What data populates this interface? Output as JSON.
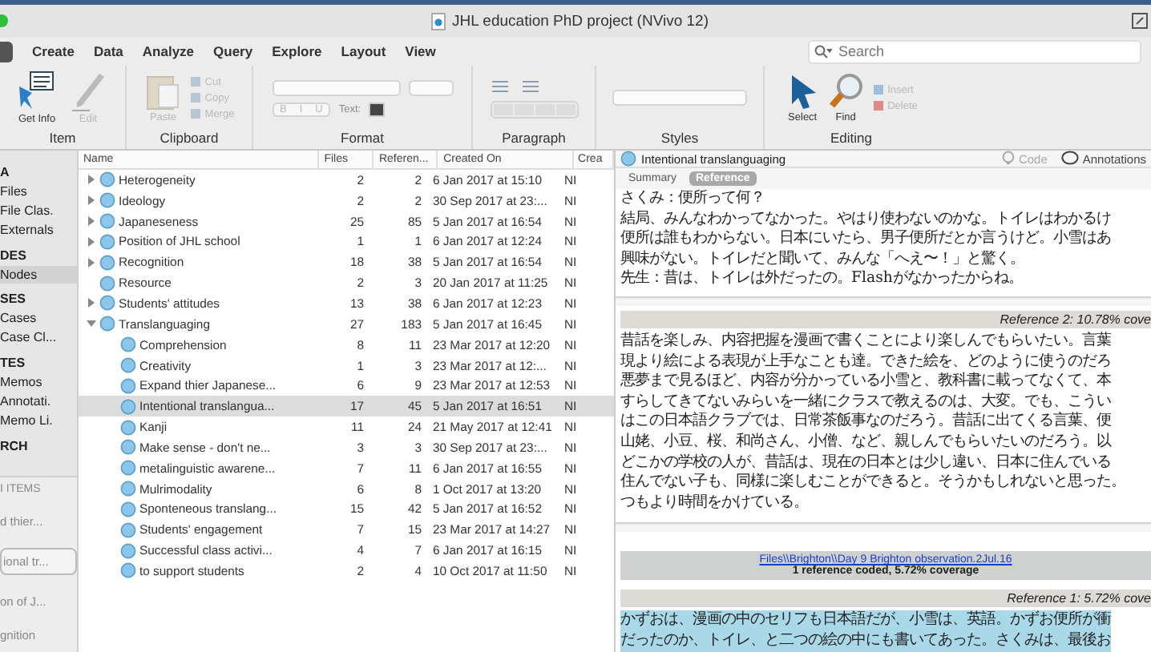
{
  "window": {
    "title": "JHL education PhD project (NVivo 12)"
  },
  "menu_tabs": [
    {
      "label": "Create"
    },
    {
      "label": "Data"
    },
    {
      "label": "Analyze"
    },
    {
      "label": "Query"
    },
    {
      "label": "Explore"
    },
    {
      "label": "Layout"
    },
    {
      "label": "View"
    }
  ],
  "search": {
    "placeholder": "Search"
  },
  "ribbon": [
    {
      "title": "Item",
      "kind": "item",
      "buttons": [
        {
          "label": "Get Info",
          "disabled": false
        },
        {
          "label": "Edit",
          "disabled": true
        }
      ]
    },
    {
      "title": "Clipboard",
      "kind": "clipboard",
      "buttons": [
        {
          "label": "Paste",
          "disabled": true
        },
        {
          "label": "Cut",
          "disabled": true
        },
        {
          "label": "Copy",
          "disabled": true
        },
        {
          "label": "Merge",
          "disabled": true
        }
      ]
    },
    {
      "title": "Format",
      "kind": "format",
      "buttons": [
        {
          "label": "B",
          "disabled": true
        },
        {
          "label": "I",
          "disabled": true
        },
        {
          "label": "U",
          "disabled": true
        },
        {
          "label": "Text:",
          "disabled": true
        }
      ]
    },
    {
      "title": "Paragraph",
      "kind": "paragraph"
    },
    {
      "title": "Styles",
      "kind": "styles"
    },
    {
      "title": "Editing",
      "kind": "editing",
      "buttons": [
        {
          "label": "Select",
          "disabled": false
        },
        {
          "label": "Find",
          "disabled": false
        },
        {
          "label": "Insert",
          "disabled": true
        },
        {
          "label": "Delete",
          "disabled": true
        }
      ]
    }
  ],
  "sidebar": {
    "items": [
      {
        "label": "A",
        "kind": "header",
        "selected": false
      },
      {
        "label": "Files",
        "kind": "item",
        "selected": false
      },
      {
        "label": "File Clas.",
        "kind": "item",
        "selected": false
      },
      {
        "label": "Externals",
        "kind": "item",
        "selected": false
      },
      {
        "label": "DES",
        "kind": "header",
        "selected": false
      },
      {
        "label": "Nodes",
        "kind": "item",
        "selected": true
      },
      {
        "label": "SES",
        "kind": "header",
        "selected": false
      },
      {
        "label": "Cases",
        "kind": "item",
        "selected": false
      },
      {
        "label": "Case Cl...",
        "kind": "item",
        "selected": false
      },
      {
        "label": "TES",
        "kind": "header",
        "selected": false
      },
      {
        "label": "Memos",
        "kind": "item",
        "selected": false
      },
      {
        "label": "Annotati.",
        "kind": "item",
        "selected": false
      },
      {
        "label": "Memo Li.",
        "kind": "item",
        "selected": false
      },
      {
        "label": "RCH",
        "kind": "header",
        "selected": false
      }
    ],
    "recent_header": "I ITEMS",
    "recent": [
      {
        "label": "d thier...",
        "selected": false
      },
      {
        "label": "ional tr...",
        "selected": true
      },
      {
        "label": "on of J...",
        "selected": false
      },
      {
        "label": "gnition",
        "selected": false
      }
    ]
  },
  "table": {
    "columns": [
      "Name",
      "Files",
      "Referen...",
      "Created On",
      "Crea"
    ],
    "rows": [
      {
        "name": "Heterogeneity",
        "files": "2",
        "refs": "2",
        "created": "6 Jan 2017 at 15:10",
        "column_5": "NI",
        "expanded": false,
        "selected": false
      },
      {
        "name": "Ideology",
        "files": "2",
        "refs": "2",
        "created": "30 Sep 2017 at 23:...",
        "column_5": "NI",
        "expanded": false,
        "selected": false
      },
      {
        "name": "Japaneseness",
        "files": "25",
        "refs": "85",
        "created": "5 Jan 2017 at 16:54",
        "column_5": "NI",
        "expanded": false,
        "selected": false
      },
      {
        "name": "Position of JHL school",
        "files": "1",
        "refs": "1",
        "created": "6 Jan 2017 at 12:24",
        "column_5": "NI",
        "expanded": false,
        "selected": false
      },
      {
        "name": "Recognition",
        "files": "18",
        "refs": "38",
        "created": "5 Jan 2017 at 16:54",
        "column_5": "NI",
        "expanded": false,
        "selected": false
      },
      {
        "name": "Resource",
        "files": "2",
        "refs": "3",
        "created": "20 Jan 2017 at 11:25",
        "column_5": "NI",
        "selected": false
      },
      {
        "name": "Students' attitudes",
        "files": "13",
        "refs": "38",
        "created": "6 Jan 2017 at 12:23",
        "column_5": "NI",
        "expanded": false,
        "selected": false
      },
      {
        "name": "Translanguaging",
        "files": "27",
        "refs": "183",
        "created": "5 Jan 2017 at 16:45",
        "column_5": "NI",
        "expanded": true,
        "selected": false,
        "children": [
          {
            "name": "Comprehension",
            "files": "8",
            "refs": "11",
            "created": "23 Mar 2017 at 12:20",
            "column_5": "NI",
            "selected": false
          },
          {
            "name": "Creativity",
            "files": "1",
            "refs": "3",
            "created": "23 Mar 2017 at 12:...",
            "column_5": "NI",
            "selected": false
          },
          {
            "name": "Expand thier Japanese...",
            "files": "6",
            "refs": "9",
            "created": "23 Mar 2017 at 12:53",
            "column_5": "NI",
            "selected": false
          },
          {
            "name": "Intentional translangua...",
            "files": "17",
            "refs": "45",
            "created": "5 Jan 2017 at 16:51",
            "column_5": "NI",
            "selected": true
          },
          {
            "name": "Kanji",
            "files": "11",
            "refs": "24",
            "created": "21 May 2017 at 12:41",
            "column_5": "NI",
            "selected": false
          },
          {
            "name": "Make sense - don't ne...",
            "files": "3",
            "refs": "3",
            "created": "30 Sep 2017 at 23:...",
            "column_5": "NI",
            "selected": false
          },
          {
            "name": "metalinguistic awarene...",
            "files": "7",
            "refs": "11",
            "created": "6 Jan 2017 at 16:55",
            "column_5": "NI",
            "selected": false
          },
          {
            "name": "Mulrimodality",
            "files": "6",
            "refs": "8",
            "created": "1 Oct 2017 at 13:20",
            "column_5": "NI",
            "selected": false
          },
          {
            "name": "Sponteneous translang...",
            "files": "15",
            "refs": "42",
            "created": "5 Jan 2017 at 16:52",
            "column_5": "NI",
            "selected": false
          },
          {
            "name": "Students' engagement",
            "files": "7",
            "refs": "15",
            "created": "23 Mar 2017 at 14:27",
            "column_5": "NI",
            "selected": false
          },
          {
            "name": "Successful class activi...",
            "files": "4",
            "refs": "7",
            "created": "6 Jan 2017 at 16:15",
            "column_5": "NI",
            "selected": false
          },
          {
            "name": "to support students",
            "files": "2",
            "refs": "4",
            "created": "10 Oct 2017 at 11:50",
            "column_5": "NI",
            "selected": false
          }
        ]
      }
    ]
  },
  "detail": {
    "title": "Intentional translanguaging",
    "actions": [
      {
        "label": "Code",
        "disabled": true
      },
      {
        "label": "Annotations",
        "disabled": false
      }
    ],
    "tabs": [
      {
        "label": "Summary",
        "selected": false
      },
      {
        "label": "Reference",
        "selected": true
      }
    ],
    "cards": [
      {
        "lines": [
          "さくみ：便所って何？",
          "結局、みんなわかってなかった。やはり使わないのかな。トイレはわかるけ",
          "便所は誰もわからない。日本にいたら、男子便所だとか言うけど。小雪はあ",
          "興味がない。トイレだと聞いて、みんな「へえ〜！」と驚く。",
          "先生：昔は、トイレは外だったの。Flashがなかったからね。"
        ],
        "highlighted": false
      },
      {
        "reference": "Reference 2: 10.78% cove",
        "lines": [
          "昔話を楽しみ、内容把握を漫画で書くことにより楽しんでもらいたい。言葉",
          "現より絵による表現が上手なことも達。できた絵を、どのように使うのだろ",
          "悪夢まで見るほど、内容が分かっている小雪と、教科書に載ってなくて、本",
          "すらしてきてないみらいを一緒にクラスで教えるのは、大変。でも、こうい",
          "はこの日本語クラブでは、日常茶飯事なのだろう。昔話に出てくる言葉、便",
          "山姥、小豆、桜、和尚さん、小僧、など、親しんでもらいたいのだろう。以",
          "どこかの学校の人が、昔話は、現在の日本とは少し違い、日本に住んでいる",
          "住んでない子も、同様に楽しむことができると。そうかもしれないと思った。",
          "つもより時間をかけている。"
        ],
        "highlighted": false
      },
      {
        "file": "Files\\\\Brighton\\\\Day 9 Brighton observation.2Jul.16",
        "coverage": "1 reference coded, 5.72% coverage",
        "reference": "Reference 1: 5.72% cove",
        "lines": [
          "かずおは、漫画の中のセリフも日本語だが、小雪は、英語。かずお便所が衝",
          "だったのか、トイレ、と二つの絵の中にも書いてあった。さくみは、最後お"
        ],
        "highlighted": true
      }
    ]
  }
}
